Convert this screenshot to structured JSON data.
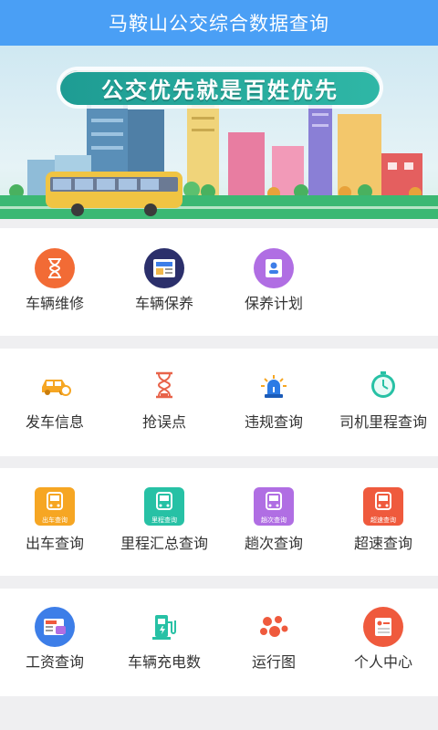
{
  "header": {
    "title": "马鞍山公交综合数据查询"
  },
  "banner": {
    "slogan": "公交优先就是百姓优先"
  },
  "section1": {
    "items": [
      {
        "label": "车辆维修",
        "icon": "hourglass-icon",
        "color": "#f26b35"
      },
      {
        "label": "车辆保养",
        "icon": "news-icon",
        "color": "#2b2f6b"
      },
      {
        "label": "保养计划",
        "icon": "person-document-icon",
        "color": "#b06ee3"
      }
    ]
  },
  "section2": {
    "items": [
      {
        "label": "发车信息",
        "icon": "car-icon",
        "color": "#f6a623"
      },
      {
        "label": "抢误点",
        "icon": "hourglass-outline-icon",
        "color": "#e8634a"
      },
      {
        "label": "违规查询",
        "icon": "alarm-light-icon",
        "color": "#2c7be5"
      },
      {
        "label": "司机里程查询",
        "icon": "stopwatch-icon",
        "color": "#27c1a5"
      }
    ]
  },
  "section3": {
    "items": [
      {
        "label": "出车查询",
        "icon": "bus-icon",
        "color": "#f6a623",
        "caption": "出车查询"
      },
      {
        "label": "里程汇总查询",
        "icon": "bus-icon",
        "color": "#27c1a5",
        "caption": "里程查询"
      },
      {
        "label": "趟次查询",
        "icon": "bus-icon",
        "color": "#b06ee3",
        "caption": "趟次查询"
      },
      {
        "label": "超速查询",
        "icon": "bus-icon",
        "color": "#ef5a3d",
        "caption": "超速查询"
      }
    ]
  },
  "section4": {
    "items": [
      {
        "label": "工资查询",
        "icon": "wallet-news-icon",
        "color": "#3d7ee8"
      },
      {
        "label": "车辆充电数",
        "icon": "charging-station-icon",
        "color": "#27c1a5"
      },
      {
        "label": "运行图",
        "icon": "dots-cluster-icon",
        "color": "#ef5a3d"
      },
      {
        "label": "个人中心",
        "icon": "user-list-icon",
        "color": "#ef5a3d"
      }
    ]
  }
}
